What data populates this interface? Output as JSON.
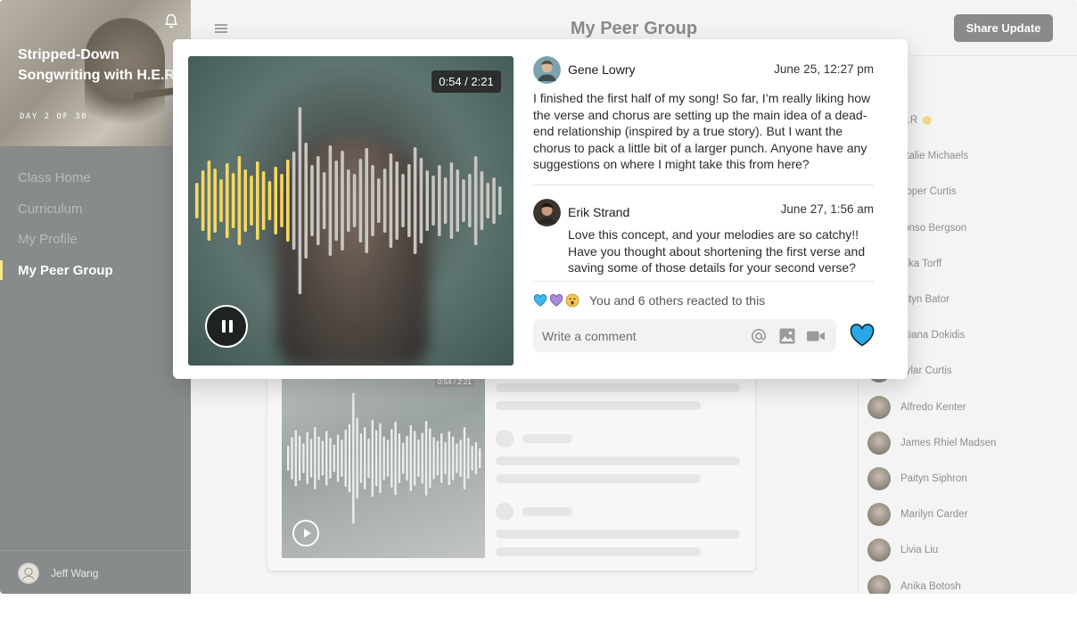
{
  "sidebar": {
    "course_title": "Stripped-Down Songwriting with H.E.R",
    "course_day": "DAY 2 OF 30",
    "nav": [
      {
        "label": "Class Home"
      },
      {
        "label": "Curriculum"
      },
      {
        "label": "My Profile"
      },
      {
        "label": "My Peer Group"
      }
    ],
    "active_index": 3,
    "user_name": "Jeff Wang"
  },
  "header": {
    "title": "My Peer Group",
    "share_label": "Share Update"
  },
  "members": {
    "heading_fragment": "s",
    "list": [
      {
        "name": "H.E.R",
        "verified": true
      },
      {
        "name": "Natalie Michaels"
      },
      {
        "name": "Cooper Curtis"
      },
      {
        "name": "Alfonso Bergson"
      },
      {
        "name": "Anika Torff"
      },
      {
        "name": "Kaityn Bator"
      },
      {
        "name": "Tatiana Dokidis"
      },
      {
        "name": "Skylar Curtis"
      },
      {
        "name": "Alfredo Kenter"
      },
      {
        "name": "James Rhiel Madsen"
      },
      {
        "name": "Paityn Siphron"
      },
      {
        "name": "Marilyn Carder"
      },
      {
        "name": "Livia Liu"
      },
      {
        "name": "Anika Botosh"
      }
    ],
    "visible_names": [
      "E.R",
      "atalie Michaels",
      "ooper Curtis",
      "fonso Bergson",
      "nika Torff",
      "aityn Bator",
      "atiana Dokidis",
      "kylar Curtis",
      "Alfredo Kenter",
      "James Rhiel Madsen",
      "Paityn Siphron",
      "Marilyn Carder",
      "Livia Liu",
      "Anika Botosh"
    ]
  },
  "background_post": {
    "time": "0:54 / 2:21"
  },
  "modal": {
    "player": {
      "time": "0:54 / 2:21",
      "progress": 0.31,
      "state": "playing",
      "played_color": "#f6d860",
      "unplayed_color": "#c9c6c1"
    },
    "comments": [
      {
        "author": "Gene Lowry",
        "date": "June 25, 12:27 pm",
        "text": "I finished the first half of my song! So far, I’m really liking how the verse and chorus are setting up the main idea of a dead-end relationship (inspired by a true story). But I want the chorus to pack a little bit of a larger punch. Anyone have any suggestions on where I might take this from here?"
      },
      {
        "author": "Erik Strand",
        "date": "June 27, 1:56 am",
        "text": "Love this concept, and your melodies are so catchy!! Have you thought about shortening the first verse and saving some of those details for your second verse?"
      }
    ],
    "reactions": {
      "icons": [
        "blue-heart-icon",
        "purple-heart-icon",
        "surprised-face-icon"
      ],
      "text": "You and 6 others reacted to this"
    },
    "comment_input": {
      "placeholder": "Write a comment"
    },
    "like_color": "#2aa7e8"
  }
}
